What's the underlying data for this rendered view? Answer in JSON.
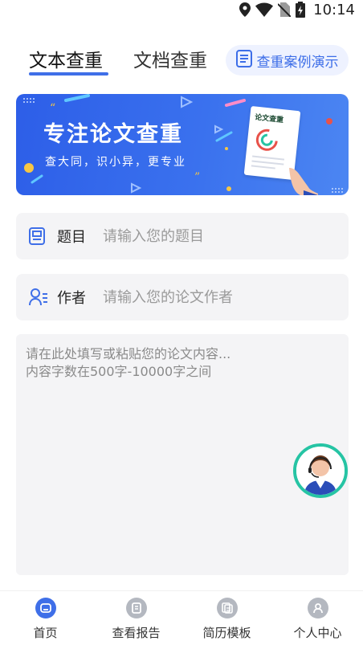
{
  "status_bar": {
    "time": "10:14",
    "icons": [
      "location-icon",
      "wifi-icon",
      "no-sim-icon",
      "battery-icon"
    ]
  },
  "tabs": [
    {
      "label": "文本查重",
      "active": true
    },
    {
      "label": "文档查重",
      "active": false
    }
  ],
  "demo_button": {
    "label": "查重案例演示",
    "icon": "document-list-icon"
  },
  "banner": {
    "title": "专注论文查重",
    "subtitle": "查大同，识小异，更专业",
    "doc_title": "论文查重"
  },
  "title_field": {
    "label": "题目",
    "placeholder": "请输入您的题目",
    "value": "",
    "icon": "document-icon"
  },
  "author_field": {
    "label": "作者",
    "placeholder": "请输入您的论文作者",
    "value": "",
    "icon": "user-list-icon"
  },
  "content_field": {
    "placeholder": "请在此处填写或粘贴您的论文内容...\n内容字数在500字-10000字之间",
    "value": ""
  },
  "bottom_nav": [
    {
      "label": "首页",
      "icon": "home-icon",
      "active": true
    },
    {
      "label": "查看报告",
      "icon": "report-icon",
      "active": false
    },
    {
      "label": "简历模板",
      "icon": "template-icon",
      "active": false
    },
    {
      "label": "个人中心",
      "icon": "profile-icon",
      "active": false
    }
  ],
  "colors": {
    "accent": "#3f6fe8",
    "support_ring": "#26c4a4",
    "field_bg": "#f4f4f6"
  }
}
